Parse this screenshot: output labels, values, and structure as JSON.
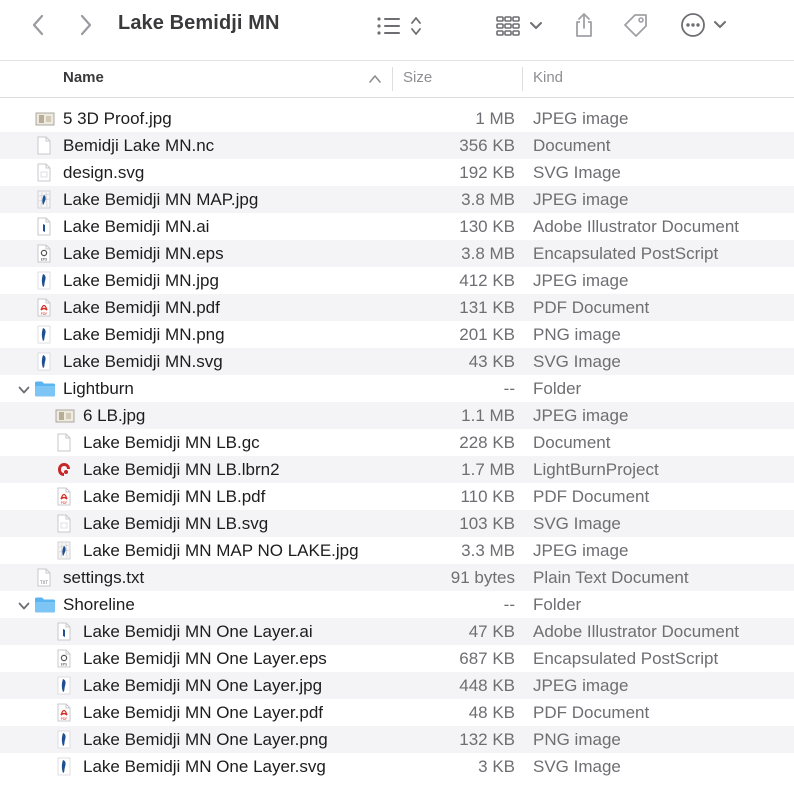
{
  "window": {
    "title": "Lake Bemidji MN"
  },
  "toolbar": {
    "back_icon": "chevron-left-icon",
    "forward_icon": "chevron-right-icon",
    "view_icon": "list-view-icon",
    "group_icon": "grid-group-icon",
    "share_icon": "share-icon",
    "tag_icon": "tag-icon",
    "more_icon": "ellipsis-circle-icon"
  },
  "columns": {
    "name": "Name",
    "size": "Size",
    "kind": "Kind"
  },
  "files": [
    {
      "name": "5 3D Proof.jpg",
      "size": "1 MB",
      "kind": "JPEG image",
      "icon": "jpeg-thumbnail-icon",
      "level": 0
    },
    {
      "name": "Bemidji Lake MN.nc",
      "size": "356 KB",
      "kind": "Document",
      "icon": "document-icon",
      "level": 0
    },
    {
      "name": "design.svg",
      "size": "192 KB",
      "kind": "SVG Image",
      "icon": "svg-file-icon",
      "level": 0
    },
    {
      "name": "Lake Bemidji MN MAP.jpg",
      "size": "3.8 MB",
      "kind": "JPEG image",
      "icon": "map-thumbnail-icon",
      "level": 0
    },
    {
      "name": "Lake Bemidji MN.ai",
      "size": "130 KB",
      "kind": "Adobe Illustrator Document",
      "icon": "illustrator-file-icon",
      "level": 0
    },
    {
      "name": "Lake Bemidji MN.eps",
      "size": "3.8 MB",
      "kind": "Encapsulated PostScript",
      "icon": "eps-file-icon",
      "level": 0
    },
    {
      "name": "Lake Bemidji MN.jpg",
      "size": "412 KB",
      "kind": "JPEG image",
      "icon": "lake-thumbnail-icon",
      "level": 0
    },
    {
      "name": "Lake Bemidji MN.pdf",
      "size": "131 KB",
      "kind": "PDF Document",
      "icon": "pdf-file-icon",
      "level": 0
    },
    {
      "name": "Lake Bemidji MN.png",
      "size": "201 KB",
      "kind": "PNG image",
      "icon": "lake-thumbnail-icon",
      "level": 0
    },
    {
      "name": "Lake Bemidji MN.svg",
      "size": "43 KB",
      "kind": "SVG Image",
      "icon": "lake-thumbnail-icon",
      "level": 0
    },
    {
      "name": "Lightburn",
      "size": "--",
      "kind": "Folder",
      "icon": "folder-icon",
      "level": 0,
      "folder": true
    },
    {
      "name": "6 LB.jpg",
      "size": "1.1 MB",
      "kind": "JPEG image",
      "icon": "jpeg-thumbnail-icon",
      "level": 1
    },
    {
      "name": "Lake Bemidji MN LB.gc",
      "size": "228 KB",
      "kind": "Document",
      "icon": "document-icon",
      "level": 1
    },
    {
      "name": "Lake Bemidji MN LB.lbrn2",
      "size": "1.7 MB",
      "kind": "LightBurnProject",
      "icon": "lightburn-icon",
      "level": 1
    },
    {
      "name": "Lake Bemidji MN LB.pdf",
      "size": "110 KB",
      "kind": "PDF Document",
      "icon": "pdf-file-icon",
      "level": 1
    },
    {
      "name": "Lake Bemidji MN LB.svg",
      "size": "103 KB",
      "kind": "SVG Image",
      "icon": "svg-file-icon",
      "level": 1
    },
    {
      "name": "Lake Bemidji MN MAP NO LAKE.jpg",
      "size": "3.3 MB",
      "kind": "JPEG image",
      "icon": "map-thumbnail-icon",
      "level": 1
    },
    {
      "name": "settings.txt",
      "size": "91 bytes",
      "kind": "Plain Text Document",
      "icon": "text-file-icon",
      "level": 0
    },
    {
      "name": "Shoreline",
      "size": "--",
      "kind": "Folder",
      "icon": "folder-icon",
      "level": 0,
      "folder": true
    },
    {
      "name": "Lake Bemidji MN One Layer.ai",
      "size": "47 KB",
      "kind": "Adobe Illustrator Document",
      "icon": "illustrator-file-icon",
      "level": 1
    },
    {
      "name": "Lake Bemidji MN One Layer.eps",
      "size": "687 KB",
      "kind": "Encapsulated PostScript",
      "icon": "eps-file-icon",
      "level": 1
    },
    {
      "name": "Lake Bemidji MN One Layer.jpg",
      "size": "448 KB",
      "kind": "JPEG image",
      "icon": "lake-thumbnail-icon",
      "level": 1
    },
    {
      "name": "Lake Bemidji MN One Layer.pdf",
      "size": "48 KB",
      "kind": "PDF Document",
      "icon": "pdf-file-icon",
      "level": 1
    },
    {
      "name": "Lake Bemidji MN One Layer.png",
      "size": "132 KB",
      "kind": "PNG image",
      "icon": "lake-thumbnail-icon",
      "level": 1
    },
    {
      "name": "Lake Bemidji MN One Layer.svg",
      "size": "3 KB",
      "kind": "SVG Image",
      "icon": "lake-thumbnail-icon",
      "level": 1
    }
  ],
  "colors": {
    "accent_folder": "#5ab4f0",
    "pdf_red": "#d93025",
    "row_alt": "#f4f4f6",
    "lake_blue": "#1f4f8f"
  }
}
